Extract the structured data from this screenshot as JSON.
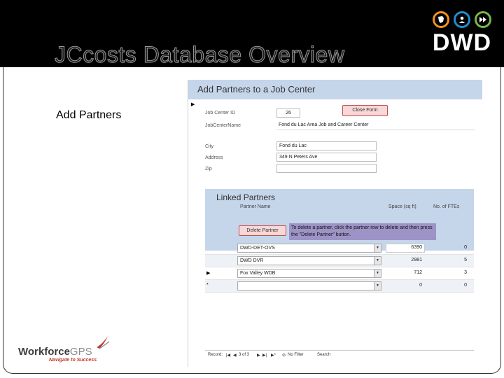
{
  "slide": {
    "title": "JCcosts Database Overview",
    "bullet": "Add Partners",
    "logo_text": "DWD",
    "logo_icons": [
      "wisconsin-map-icon",
      "people-icon",
      "forward-arrows-icon"
    ],
    "logo_colors": [
      "#f29121",
      "#1f8fd1",
      "#7ab648"
    ]
  },
  "form": {
    "title": "Add Partners to a Job Center",
    "close_button": "Close Form",
    "fields": [
      {
        "label": "Job Center ID",
        "value": "26"
      },
      {
        "label": "JobCenterName",
        "value": "Fond du Lac Area Job and Career Center"
      },
      {
        "label": "City",
        "value": "Fond du Lac"
      },
      {
        "label": "Address",
        "value": "349 N Peters Ave"
      },
      {
        "label": "Zip",
        "value": ""
      }
    ],
    "subform": {
      "title": "Linked Partners",
      "columns": [
        "Partner Name",
        "Space (sq ft)",
        "No. of FTEs"
      ],
      "delete_button": "Delete Partner",
      "instructions": "To delete a partner, click the partner row to delete and then press the \"Delete Partner\" button.",
      "rows": [
        {
          "partner": "DWD-DET-OVS",
          "space": "6390",
          "ftes": "0",
          "indicator": ""
        },
        {
          "partner": "DWD DVR",
          "space": "2981",
          "ftes": "5",
          "indicator": ""
        },
        {
          "partner": "Fox Valley WDB",
          "space": "712",
          "ftes": "3",
          "indicator": "▶"
        },
        {
          "partner": "",
          "space": "0",
          "ftes": "0",
          "indicator": "*"
        }
      ]
    },
    "navigation": {
      "record_label": "Record:",
      "position": "3 of 3",
      "filter": "No Filter",
      "search": "Search"
    }
  },
  "footer_logo": {
    "name_part1": "Workforce",
    "name_part2": "GPS",
    "tagline": "Navigate to Success",
    "accent_color": "#c0392b"
  }
}
